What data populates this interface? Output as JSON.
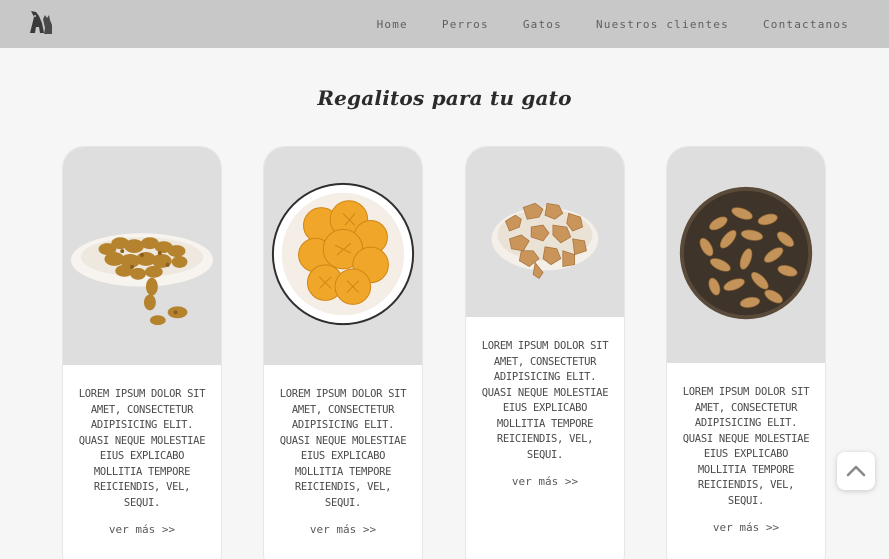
{
  "nav": {
    "logo_icon": "dog-cat-logo-icon",
    "links": [
      "Home",
      "Perros",
      "Gatos",
      "Nuestros clientes",
      "Contactanos"
    ]
  },
  "section": {
    "title": "Regalitos para tu gato"
  },
  "cards": [
    {
      "image": "bone-treats-plate",
      "text": "Lorem ipsum dolor sit amet, consectetur adipisicing elit. Quasi neque molestiae eius explicabo mollitia tempore reiciendis, vel, sequi.",
      "link": "ver más >>"
    },
    {
      "image": "round-cookies-bowl",
      "text": "Lorem ipsum dolor sit amet, consectetur adipisicing elit. Quasi neque molestiae eius explicabo mollitia tempore reiciendis, vel, sequi.",
      "link": "ver más >>"
    },
    {
      "image": "dog-shaped-biscuits",
      "text": "Lorem ipsum dolor sit amet, consectetur adipisicing elit. Quasi neque molestiae eius explicabo mollitia tempore reiciendis, vel, sequi.",
      "link": "ver más >>"
    },
    {
      "image": "bone-biscuits-bowl",
      "text": "Lorem ipsum dolor sit amet, consectetur adipisicing elit. Quasi neque molestiae eius explicabo mollitia tempore reiciendis, vel, sequi.",
      "link": "ver más >>"
    }
  ],
  "scroll_top": {
    "icon": "chevron-up-icon"
  },
  "colors": {
    "navbar": "#c8c8c8",
    "background": "#f6f6f6",
    "image_bg": "#dedede"
  }
}
